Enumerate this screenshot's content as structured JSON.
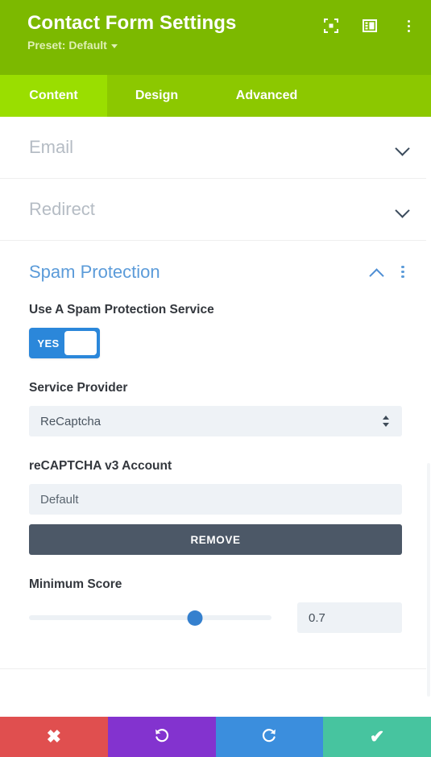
{
  "header": {
    "title": "Contact Form Settings",
    "preset_label": "Preset: Default",
    "icons": {
      "focus": "focus-target-icon",
      "layout": "panel-layout-icon",
      "menu": "more-options-icon"
    }
  },
  "tabs": [
    {
      "label": "Content",
      "active": true
    },
    {
      "label": "Design",
      "active": false
    },
    {
      "label": "Advanced",
      "active": false
    }
  ],
  "sections": {
    "email": {
      "title": "Email",
      "state": "collapsed"
    },
    "redirect": {
      "title": "Redirect",
      "state": "collapsed"
    },
    "spam": {
      "title": "Spam Protection",
      "state": "expanded",
      "use_service": {
        "label": "Use A Spam Protection Service",
        "toggle_value": "YES"
      },
      "service_provider": {
        "label": "Service Provider",
        "value": "ReCaptcha"
      },
      "account": {
        "label": "reCAPTCHA v3 Account",
        "value": "Default",
        "remove_label": "REMOVE"
      },
      "minimum_score": {
        "label": "Minimum Score",
        "value": "0.7",
        "slider_percent": 68.5
      }
    }
  },
  "bottom_bar": {
    "close_label": "✖",
    "undo_label": "undo-icon",
    "redo_label": "redo-icon",
    "save_label": "✔"
  },
  "colors": {
    "header_green": "#7cb900",
    "tab_green": "#8cc800",
    "tab_active_green": "#9ade00",
    "accent_blue": "#5b9bd9",
    "toggle_blue": "#2b87da",
    "remove_gray": "#4c5867",
    "close_red": "#e04f4f",
    "undo_purple": "#8333cf",
    "redo_blue": "#3b8edd",
    "save_green": "#47c49f"
  }
}
